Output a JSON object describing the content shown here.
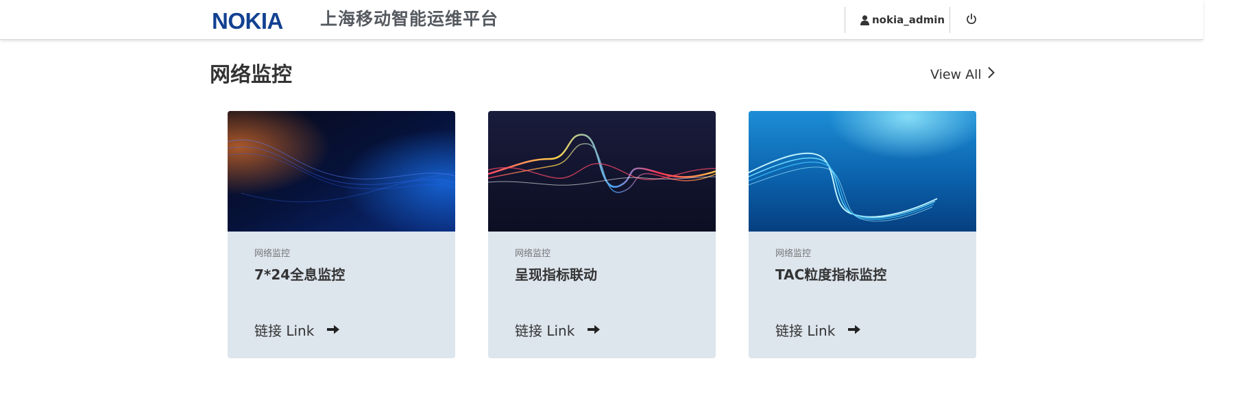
{
  "header": {
    "logo": "NOKIA",
    "app_title": "上海移动智能运维平台",
    "username": "nokia_admin",
    "user_icon": "user-icon",
    "power_icon": "power-icon",
    "brand_color": "#124191"
  },
  "section": {
    "title": "网络监控",
    "view_all": "View All",
    "view_all_icon": "chevron-right-icon"
  },
  "cards": [
    {
      "category": "网络监控",
      "name": "7*24全息监控",
      "link": "链接 Link",
      "link_icon": "arrow-right-icon"
    },
    {
      "category": "网络监控",
      "name": "呈现指标联动",
      "link": "链接 Link",
      "link_icon": "arrow-right-icon"
    },
    {
      "category": "网络监控",
      "name": "TAC粒度指标监控",
      "link": "链接 Link",
      "link_icon": "arrow-right-icon"
    }
  ]
}
